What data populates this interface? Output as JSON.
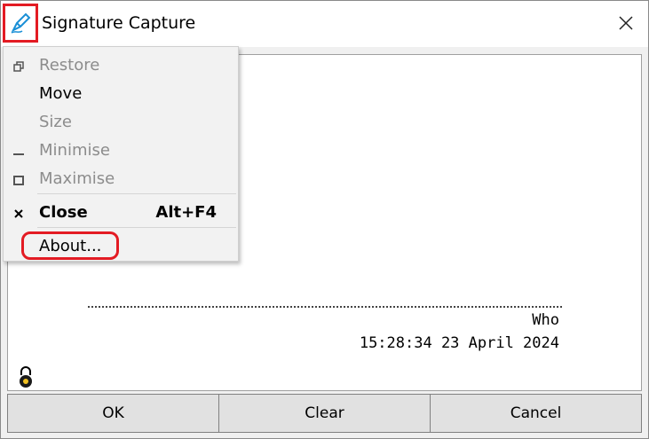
{
  "window": {
    "title": "Signature Capture"
  },
  "system_menu": {
    "items": [
      {
        "label": "Restore",
        "enabled": false,
        "icon": "restore-icon"
      },
      {
        "label": "Move",
        "enabled": true,
        "icon": ""
      },
      {
        "label": "Size",
        "enabled": false,
        "icon": ""
      },
      {
        "label": "Minimise",
        "enabled": false,
        "icon": "minimise-icon"
      },
      {
        "label": "Maximise",
        "enabled": false,
        "icon": "maximise-icon"
      },
      {
        "label": "Close",
        "enabled": true,
        "icon": "close-icon",
        "accelerator": "Alt+F4"
      },
      {
        "label": "About...",
        "enabled": true,
        "icon": ""
      }
    ]
  },
  "signature": {
    "name": "Who",
    "timestamp": "15:28:34 23 April 2024"
  },
  "buttons": {
    "ok": "OK",
    "clear": "Clear",
    "cancel": "Cancel"
  },
  "colors": {
    "highlight": "#e31b23",
    "pen": "#1a8fd6"
  }
}
